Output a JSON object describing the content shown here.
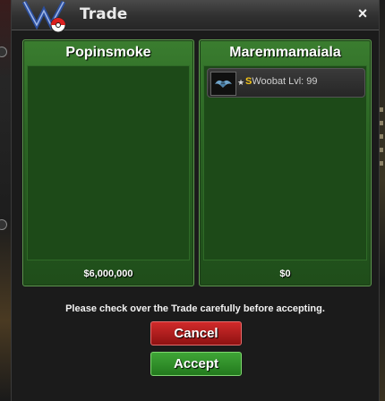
{
  "window": {
    "title": "Trade",
    "close_label": "×"
  },
  "left_panel": {
    "player": "Popinsmoke",
    "money": "$6,000,000",
    "items": []
  },
  "right_panel": {
    "player": "Maremmamaiala",
    "money": "$0",
    "items": [
      {
        "badge": "S",
        "name": "Woobat Lvl: 99",
        "icon": "woobat-icon",
        "marker": "★"
      }
    ]
  },
  "notice": "Please check over the Trade carefully before accepting.",
  "buttons": {
    "cancel": "Cancel",
    "accept": "Accept"
  },
  "colors": {
    "panel_green": "#2a6323",
    "cancel_red": "#b11f1f",
    "accept_green": "#2f8f29",
    "shiny_gold": "#f5c518"
  }
}
